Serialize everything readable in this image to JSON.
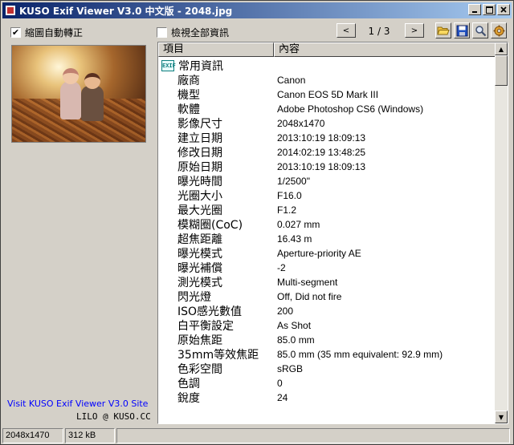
{
  "window": {
    "title": "KUSO Exif Viewer V3.0 中文版 - 2048.jpg"
  },
  "controls": {
    "auto_rotate_label": "縮圖自動轉正",
    "auto_rotate_checked": true,
    "view_all_label": "檢視全部資訊",
    "view_all_checked": false,
    "page_indicator": "1 / 3"
  },
  "table": {
    "headers": {
      "item": "項目",
      "content": "內容"
    },
    "group_label": "常用資訊",
    "rows": [
      {
        "key": "廠商",
        "value": "Canon"
      },
      {
        "key": "機型",
        "value": "Canon EOS 5D Mark III"
      },
      {
        "key": "軟體",
        "value": "Adobe Photoshop CS6 (Windows)"
      },
      {
        "key": "影像尺寸",
        "value": "2048x1470"
      },
      {
        "key": "建立日期",
        "value": "2013:10:19 18:09:13"
      },
      {
        "key": "修改日期",
        "value": "2014:02:19 13:48:25"
      },
      {
        "key": "原始日期",
        "value": "2013:10:19 18:09:13"
      },
      {
        "key": "曝光時間",
        "value": "1/2500\""
      },
      {
        "key": "光圈大小",
        "value": "F16.0"
      },
      {
        "key": "最大光圈",
        "value": "F1.2"
      },
      {
        "key": "模糊圈(CoC)",
        "value": "0.027 mm"
      },
      {
        "key": "超焦距離",
        "value": "16.43 m"
      },
      {
        "key": "曝光模式",
        "value": "Aperture-priority AE"
      },
      {
        "key": "曝光補償",
        "value": "-2"
      },
      {
        "key": "測光模式",
        "value": "Multi-segment"
      },
      {
        "key": "閃光燈",
        "value": "Off, Did not fire"
      },
      {
        "key": "ISO感光數值",
        "value": "200"
      },
      {
        "key": "白平衡設定",
        "value": "As Shot"
      },
      {
        "key": "原始焦距",
        "value": "85.0 mm"
      },
      {
        "key": "35mm等效焦距",
        "value": "85.0 mm (35 mm equivalent: 92.9 mm)"
      },
      {
        "key": "色彩空間",
        "value": "sRGB"
      },
      {
        "key": "色調",
        "value": "0"
      },
      {
        "key": "銳度",
        "value": "24"
      }
    ]
  },
  "footer": {
    "link_text": "Visit KUSO Exif Viewer V3.0 Site",
    "credit": "LILO @ KUSO.CC"
  },
  "statusbar": {
    "dimensions": "2048x1470",
    "filesize": "312 kB"
  },
  "icons": {
    "open": "folder-open-icon",
    "save": "save-disk-icon",
    "search": "magnifier-icon",
    "settings": "gear-icon"
  },
  "colors": {
    "titlebar_start": "#0a246a",
    "titlebar_end": "#a6caf0",
    "link": "#0000ff",
    "group_icon": "#0d7e7e"
  }
}
